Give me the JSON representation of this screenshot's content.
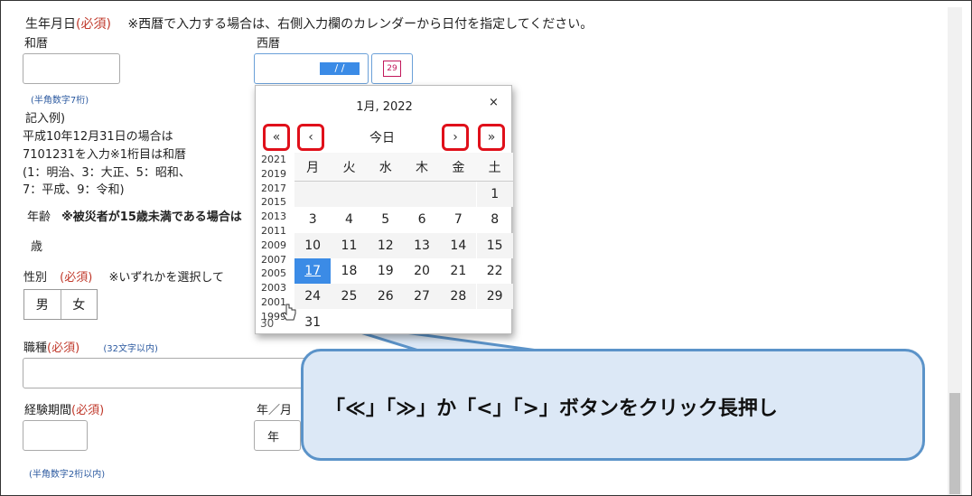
{
  "form": {
    "birthdate_label": "生年月日",
    "required": "(必須)",
    "birthdate_note": "※西暦で入力する場合は、右側入力欄のカレンダーから日付を指定してください。",
    "wareki_label": "和暦",
    "seireki_label": "西暦",
    "date_value": " / /",
    "calendar_icon_text": "29",
    "wareki_hint": "(半角数字7桁)",
    "example_title": "記入例)",
    "example_line1": "平成10年12月31日の場合は",
    "example_line2": "7101231を入力※1桁目は和暦",
    "example_line3": "(1：明治、3：大正、5：昭和、",
    "example_line4": "7：平成、9：令和)",
    "age_label": "年齢",
    "age_note": "※被災者が15歳未満である場合は",
    "age_unit": "歳",
    "gender_label": "性別",
    "gender_required": "(必須)",
    "gender_note": "※いずれかを選択して",
    "gender_options": [
      "男",
      "女"
    ],
    "job_label": "職種",
    "job_required": "(必須)",
    "job_hint": "(32文字以内)",
    "exp_label": "経験期間",
    "exp_required": "(必須)",
    "exp_unit_label": "年／月",
    "exp_year_option": "年",
    "exp_hint": "(半角数字2桁以内)"
  },
  "calendar": {
    "title": "1月, 2022",
    "close": "×",
    "prev_year": "«",
    "prev_month": "‹",
    "today": "今日",
    "next_month": "›",
    "next_year": "»",
    "years": [
      "2021",
      "2019",
      "2017",
      "2015",
      "2013",
      "2011",
      "2009",
      "2007",
      "2005",
      "2003",
      "2001",
      "1999"
    ],
    "weekdays": [
      "月",
      "火",
      "水",
      "木",
      "金",
      "土"
    ],
    "weeks": [
      [
        "",
        "",
        "",
        "",
        "",
        "1"
      ],
      [
        "3",
        "4",
        "5",
        "6",
        "7",
        "8"
      ],
      [
        "10",
        "11",
        "12",
        "13",
        "14",
        "15"
      ],
      [
        "17",
        "18",
        "19",
        "20",
        "21",
        "22"
      ],
      [
        "24",
        "25",
        "26",
        "27",
        "28",
        "29"
      ],
      [
        "31",
        "",
        "",
        "",
        "",
        ""
      ]
    ],
    "selected_day": "17",
    "partial_row_text": "30"
  },
  "callout": {
    "text": "「≪」「≫」か「<」「>」ボタンをクリック長押し"
  },
  "colors": {
    "highlight_border": "#e0101a",
    "selected_day": "#3b8be6",
    "callout_fill": "#dce8f6",
    "callout_border": "#5b93c9"
  }
}
